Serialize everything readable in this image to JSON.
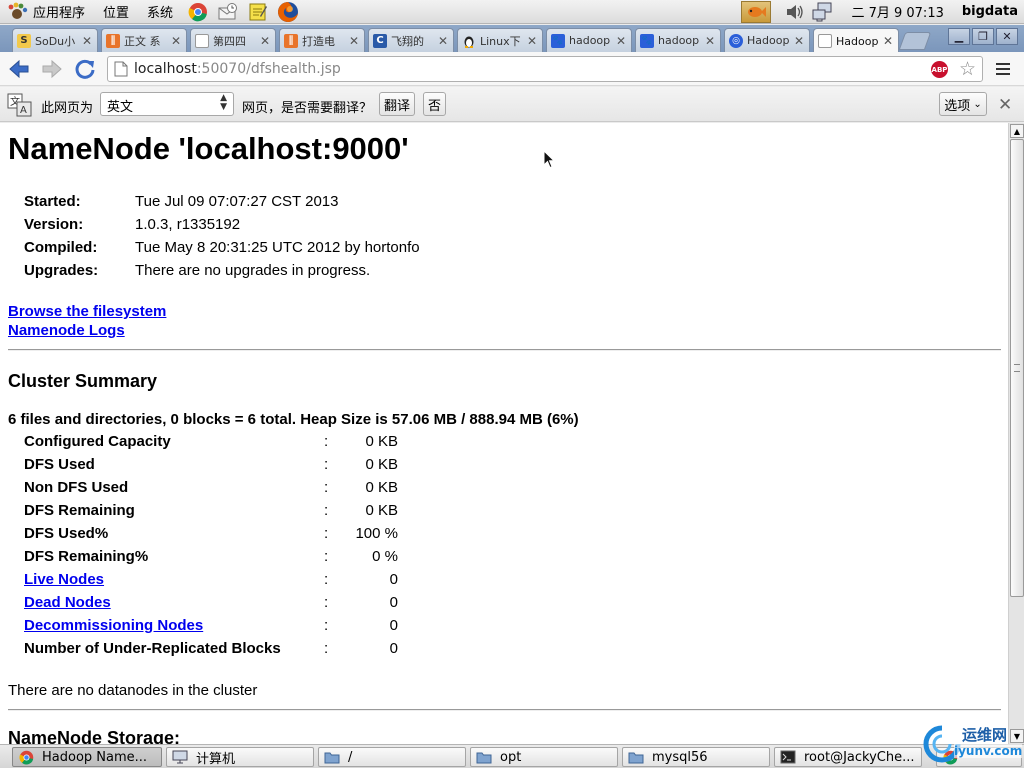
{
  "panel": {
    "menus": [
      "应用程序",
      "位置",
      "系统"
    ],
    "clock": "二 7月  9 07:13",
    "hostname": "bigdata"
  },
  "tabs": [
    {
      "title": "SoDu小",
      "icon": "sodu-icon"
    },
    {
      "title": "正文 系",
      "icon": "page-orange-icon"
    },
    {
      "title": "第四四",
      "icon": "document-icon"
    },
    {
      "title": "打造电",
      "icon": "page-orange-icon"
    },
    {
      "title": "飞翔的",
      "icon": "page-blue-icon"
    },
    {
      "title": "Linux下",
      "icon": "tux-icon"
    },
    {
      "title": "hadoop",
      "icon": "baidu-icon"
    },
    {
      "title": "hadoop",
      "icon": "baidu-icon"
    },
    {
      "title": "Hadoop",
      "icon": "baidu-icon"
    },
    {
      "title": "Hadoop",
      "icon": "document-icon"
    }
  ],
  "toolbar": {
    "url_host": "localhost",
    "url_rest": ":50070/dfshealth.jsp",
    "abp_label": "ABP"
  },
  "translate_bar": {
    "label": "此网页为",
    "language": "英文",
    "question": "网页，是否需要翻译？",
    "translate_button": "翻译",
    "no_button": "否",
    "options_button": "选项"
  },
  "page": {
    "title": "NameNode 'localhost:9000'",
    "info": [
      {
        "label": "Started:",
        "value": "Tue Jul 09 07:07:27 CST 2013"
      },
      {
        "label": "Version:",
        "value": "1.0.3, r1335192"
      },
      {
        "label": "Compiled:",
        "value": "Tue May  8 20:31:25 UTC 2012 by hortonfo"
      },
      {
        "label": "Upgrades:",
        "value": "There are no upgrades in progress."
      }
    ],
    "links": {
      "browse": "Browse the filesystem",
      "logs": "Namenode Logs"
    },
    "cluster_heading": "Cluster Summary",
    "summary_line": "6 files and directories, 0 blocks = 6 total. Heap Size is 57.06 MB / 888.94 MB (6%)",
    "summary_sep": ":",
    "summary": [
      {
        "label": "Configured Capacity",
        "value": "0 KB",
        "link": false
      },
      {
        "label": "DFS Used",
        "value": "0 KB",
        "link": false
      },
      {
        "label": "Non DFS Used",
        "value": "0 KB",
        "link": false
      },
      {
        "label": "DFS Remaining",
        "value": "0 KB",
        "link": false
      },
      {
        "label": "DFS Used%",
        "value": "100 %",
        "link": false
      },
      {
        "label": "DFS Remaining%",
        "value": "0 %",
        "link": false
      },
      {
        "label": "Live Nodes",
        "value": "0",
        "link": true
      },
      {
        "label": "Dead Nodes",
        "value": "0",
        "link": true
      },
      {
        "label": "Decommissioning Nodes",
        "value": "0",
        "link": true
      },
      {
        "label": "Number of Under-Replicated Blocks",
        "value": "0",
        "link": false
      }
    ],
    "no_datanodes": "There are no datanodes in the cluster",
    "storage_heading": "NameNode Storage:"
  },
  "taskbar": [
    {
      "label": "Hadoop Name...",
      "icon": "chrome-icon"
    },
    {
      "label": "计算机",
      "icon": "computer-icon"
    },
    {
      "label": "/",
      "icon": "folder-icon"
    },
    {
      "label": "opt",
      "icon": "folder-icon"
    },
    {
      "label": "mysql56",
      "icon": "folder-icon"
    },
    {
      "label": "root@JackyChe...",
      "icon": "terminal-icon"
    }
  ],
  "watermark": {
    "line1": "运维网",
    "line2": "iyunv.com"
  },
  "colors": {
    "link": "#0000ee",
    "tabstrip": "#8fa8c8",
    "abp_red": "#c8102e"
  }
}
